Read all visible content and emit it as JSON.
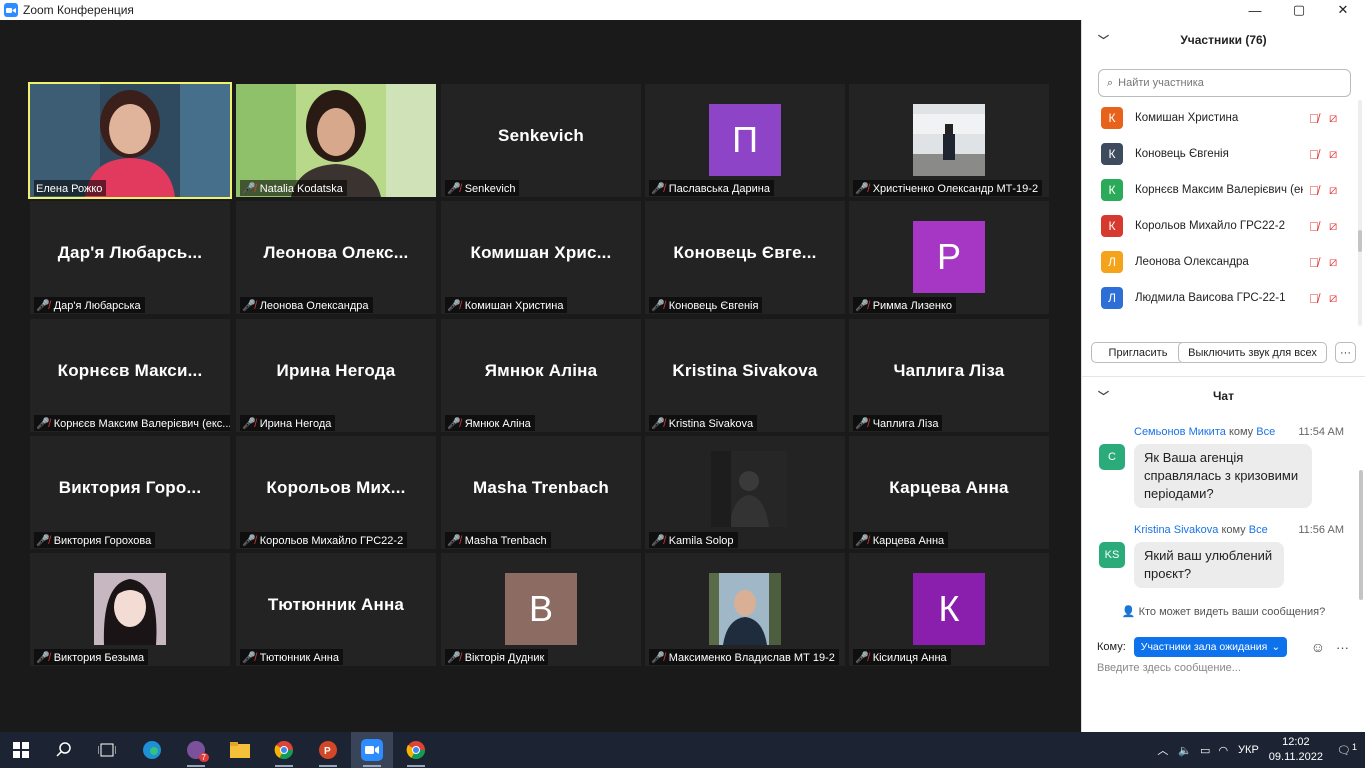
{
  "window": {
    "title": "Zoom Конференция"
  },
  "tiles": [
    {
      "big": "",
      "label": "Елена Рожко",
      "kind": "video1",
      "muted": false,
      "active": true
    },
    {
      "big": "",
      "label": "Natalia Kodatska",
      "kind": "video2",
      "muted": true
    },
    {
      "big": "Senkevich",
      "label": "Senkevich",
      "kind": "name",
      "muted": true
    },
    {
      "big": "П",
      "label": "Паславська Дарина",
      "kind": "avatar",
      "color": "#8e44c7",
      "muted": true
    },
    {
      "big": "",
      "label": "Христіченко Олександр МТ-19-2",
      "kind": "photo",
      "muted": true
    },
    {
      "big": "Дар'я Любарсь...",
      "label": "Дар'я Любарська",
      "kind": "name",
      "muted": true
    },
    {
      "big": "Леонова Олекс...",
      "label": "Леонова Олександра",
      "kind": "name",
      "muted": true
    },
    {
      "big": "Комишан Хрис...",
      "label": "Комишан Христина",
      "kind": "name",
      "muted": true
    },
    {
      "big": "Коновець Євге...",
      "label": "Коновець Євгенія",
      "kind": "name",
      "muted": true
    },
    {
      "big": "Р",
      "label": "Римма Лизенко",
      "kind": "avatar",
      "color": "#a637c4",
      "muted": true
    },
    {
      "big": "Корнєєв Макси...",
      "label": "Корнєєв Максим Валерієвич (екс...",
      "kind": "name",
      "muted": true
    },
    {
      "big": "Ирина Негода",
      "label": "Ирина Негода",
      "kind": "name",
      "muted": true
    },
    {
      "big": "Ямнюк Аліна",
      "label": "Ямнюк Аліна",
      "kind": "name",
      "muted": true
    },
    {
      "big": "Kristina Sivakova",
      "label": "Kristina Sivakova",
      "kind": "name",
      "muted": true
    },
    {
      "big": "Чаплига Ліза",
      "label": "Чаплига Ліза",
      "kind": "name",
      "muted": true
    },
    {
      "big": "Виктория Горо...",
      "label": "Виктория Горохова",
      "kind": "name",
      "muted": true
    },
    {
      "big": "Корольов Мих...",
      "label": "Корольов Михайло ГРС22-2",
      "kind": "name",
      "muted": true
    },
    {
      "big": "Masha Trenbach",
      "label": "Masha Trenbach",
      "kind": "name",
      "muted": true
    },
    {
      "big": "",
      "label": "Kamila Solop",
      "kind": "photo-dark",
      "muted": true
    },
    {
      "big": "Карцева Анна",
      "label": "Карцева Анна",
      "kind": "name",
      "muted": true
    },
    {
      "big": "",
      "label": "Виктория Безыма",
      "kind": "photo-anime",
      "muted": true
    },
    {
      "big": "Тютюнник Анна",
      "label": "Тютюнник Анна",
      "kind": "name",
      "muted": true
    },
    {
      "big": "В",
      "label": "Вікторія Дудник",
      "kind": "avatar",
      "color": "#8c6b63",
      "muted": true
    },
    {
      "big": "",
      "label": "Максименко Владислав МТ 19-2",
      "kind": "photo-forest",
      "muted": true
    },
    {
      "big": "К",
      "label": "Кісилиця Анна",
      "kind": "avatar",
      "color": "#8a1fad",
      "muted": true
    }
  ],
  "participants": {
    "header": "Участники (76)",
    "search_placeholder": "Найти участника",
    "list": [
      {
        "initial": "К",
        "name": "Комишан Христина",
        "color": "#e8621c"
      },
      {
        "initial": "К",
        "name": "Коновець Євгенія",
        "color": "#3e4a5e"
      },
      {
        "initial": "К",
        "name": "Корнєєв Максим Валерієвич (ек...",
        "color": "#2bab5a"
      },
      {
        "initial": "К",
        "name": "Корольов Михайло ГРС22-2",
        "color": "#d63a2f"
      },
      {
        "initial": "Л",
        "name": "Леонова Олександра",
        "color": "#f4a31b"
      },
      {
        "initial": "Л",
        "name": "Людмила Ваисова ГРС-22-1",
        "color": "#2d6fd6"
      }
    ],
    "invite": "Пригласить",
    "mute_all": "Выключить звук для всех",
    "more": "···"
  },
  "chat": {
    "header": "Чат",
    "messages": [
      {
        "from": "Семьонов Микита",
        "to_word": "кому",
        "to": "Все",
        "time": "11:54 AM",
        "initial": "С",
        "text_lines": [
          "Як Ваша агенція",
          "справлялась з кризовими",
          "періодами?"
        ]
      },
      {
        "from": "Kristina Sivakova",
        "to_word": "кому",
        "to": "Все",
        "time": "11:56 AM",
        "initial": "KS",
        "text_lines": [
          "Який ваш улюблений",
          "проєкт?"
        ]
      }
    ],
    "who_can_see": "Кто может видеть ваши сообщения?",
    "to_label": "Кому:",
    "to_value": "Участники зала ожидания",
    "input_placeholder": "Введите здесь сообщение..."
  },
  "taskbar": {
    "badge": "7",
    "lang": "УКР",
    "time": "12:02",
    "date": "09.11.2022",
    "notif": "1"
  }
}
